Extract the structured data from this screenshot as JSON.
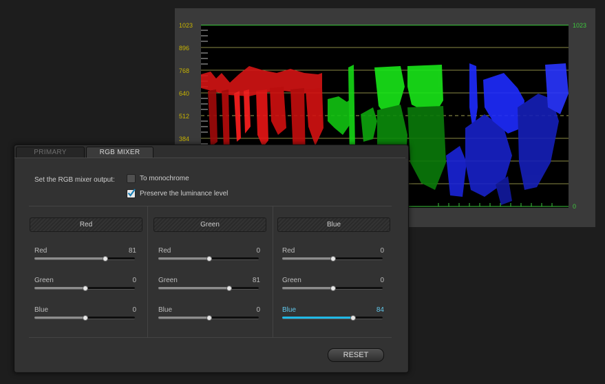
{
  "scope": {
    "left_scale": [
      "1023",
      "896",
      "768",
      "640",
      "512",
      "384"
    ],
    "right_scale_top": "1023",
    "right_scale_bottom": "0",
    "colors": {
      "red": "#ff1a1a",
      "green": "#19e619",
      "blue": "#1f2cff",
      "grid": "#c8c864"
    }
  },
  "tabs": [
    {
      "label": "PRIMARY",
      "active": false
    },
    {
      "label": "RGB MIXER",
      "active": true
    }
  ],
  "mixer": {
    "output_label": "Set the RGB mixer output:",
    "monochrome": {
      "label": "To monochrome",
      "checked": false
    },
    "preserve": {
      "label": "Preserve the luminance level",
      "checked": true
    },
    "columns": [
      {
        "title": "Red",
        "sliders": [
          {
            "label": "Red",
            "value": "81",
            "fraction": 0.7
          },
          {
            "label": "Green",
            "value": "0",
            "fraction": 0.5
          },
          {
            "label": "Blue",
            "value": "0",
            "fraction": 0.5
          }
        ]
      },
      {
        "title": "Green",
        "sliders": [
          {
            "label": "Red",
            "value": "0",
            "fraction": 0.5
          },
          {
            "label": "Green",
            "value": "81",
            "fraction": 0.7
          },
          {
            "label": "Blue",
            "value": "0",
            "fraction": 0.5
          }
        ]
      },
      {
        "title": "Blue",
        "sliders": [
          {
            "label": "Red",
            "value": "0",
            "fraction": 0.5
          },
          {
            "label": "Green",
            "value": "0",
            "fraction": 0.5
          },
          {
            "label": "Blue",
            "value": "84",
            "fraction": 0.7,
            "active": true
          }
        ]
      }
    ],
    "reset_label": "RESET"
  }
}
